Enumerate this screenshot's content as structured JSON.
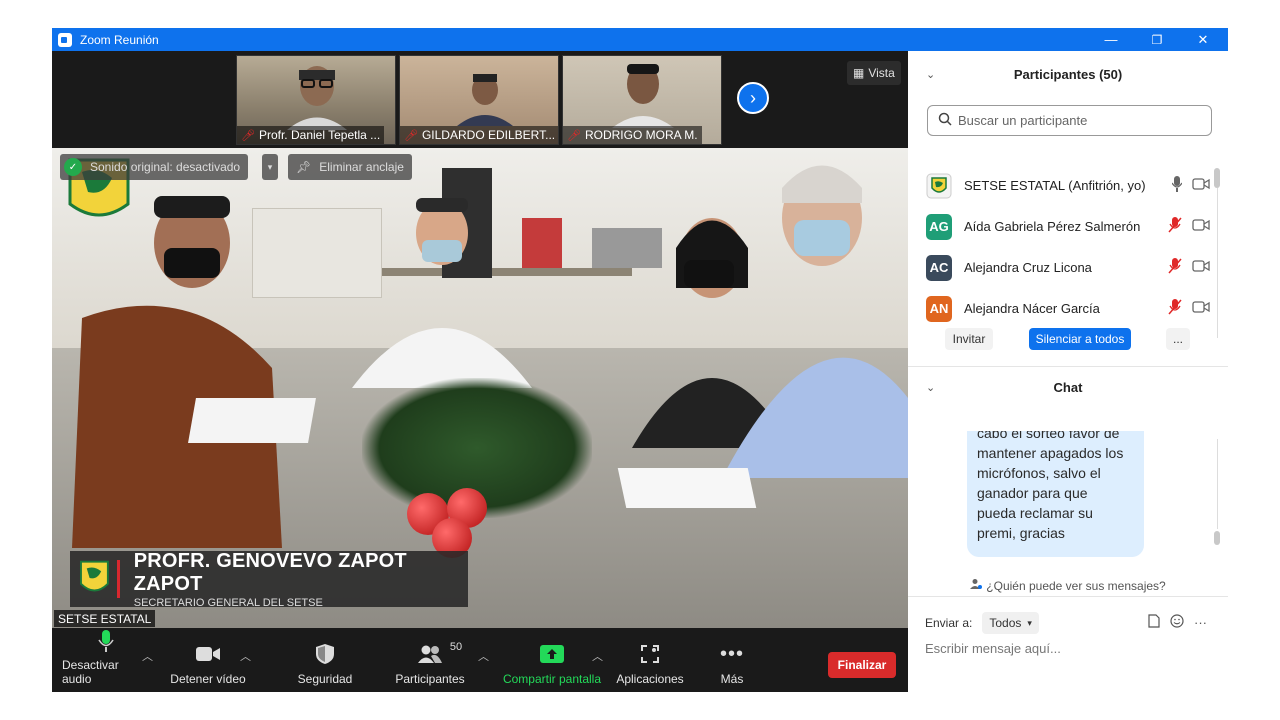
{
  "window": {
    "title": "Zoom Reunión",
    "controls": {
      "minimize": "—",
      "restore": "❐",
      "close": "✕"
    }
  },
  "thumbnails": [
    {
      "name": "Profr. Daniel Tepetla ...",
      "muted": true,
      "bg": "#8a7f6c"
    },
    {
      "name": "GILDARDO EDILBERT...",
      "muted": true,
      "bg": "#a38a72"
    },
    {
      "name": "RODRIGO MORA M.",
      "muted": true,
      "bg": "#b4ab9b"
    }
  ],
  "view_button": {
    "label": "Vista"
  },
  "main_video": {
    "original_sound_label": "Sonido original: desactivado",
    "unpin_label": "Eliminar anclaje",
    "speaker_name": "PROFR. GENOVEVO ZAPOT ZAPOT",
    "speaker_role": "SECRETARIO GENERAL DEL SETSE",
    "participant_label": "SETSE ESTATAL"
  },
  "toolbar": {
    "mute": "Desactivar audio",
    "video": "Detener vídeo",
    "security": "Seguridad",
    "participants": "Participantes",
    "participants_count": "50",
    "share": "Compartir pantalla",
    "apps": "Aplicaciones",
    "more": "Más",
    "end": "Finalizar"
  },
  "participants_panel": {
    "title": "Participantes (50)",
    "search_placeholder": "Buscar un participante",
    "list": [
      {
        "initials": "",
        "name": "SETSE ESTATAL (Anfitrión, yo)",
        "color": "#f2d33a",
        "mic": "on"
      },
      {
        "initials": "AG",
        "name": "Aída Gabriela Pérez Salmerón",
        "color": "#1f9e77",
        "mic": "muted"
      },
      {
        "initials": "AC",
        "name": "Alejandra Cruz Licona",
        "color": "#3a4a5c",
        "mic": "muted"
      },
      {
        "initials": "AN",
        "name": "Alejandra Nácer García",
        "color": "#e0661f",
        "mic": "muted"
      }
    ],
    "invite": "Invitar",
    "mute_all": "Silenciar a todos",
    "more": "..."
  },
  "chat_panel": {
    "title": "Chat",
    "message_lines": [
      "cabo el sorteo favor de",
      "mantener apagados los",
      "micrófonos, salvo el",
      "ganador para que",
      "pueda reclamar su",
      "premi, gracias"
    ],
    "who_can_see": "¿Quién puede ver sus mensajes?",
    "send_to_label": "Enviar a:",
    "send_to_value": "Todos",
    "compose_placeholder": "Escribir mensaje aquí..."
  },
  "colors": {
    "zoom_blue": "#0e72ed",
    "end_red": "#d92b2b",
    "share_green": "#23d959",
    "muted_red": "#e02828"
  }
}
